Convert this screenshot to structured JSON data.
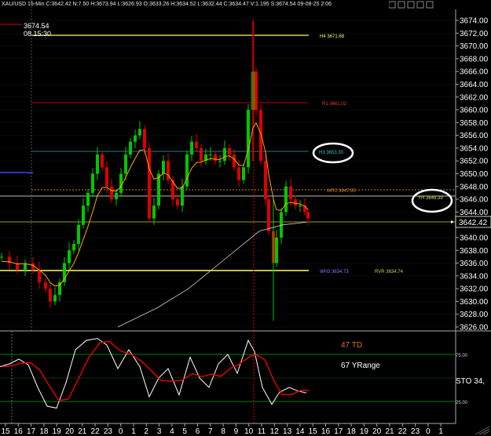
{
  "header": {
    "ohlc": "XAU/USD 15-Min C:3642.42 N:7.50 H:3673.94 L:3626.93 O:3633.26 H:3634.52 L:3632.44 C:3634.47 V:1.195 S:3674.54 09-08-25 2:06",
    "toolbar_label": "15:30 | C:3633.26 H:3634.52 L:3632.44 O:3634.47 V:1.195 S:3674.54 09-08-25 2:06"
  },
  "crosshair": {
    "price_label": "3674.54",
    "time_label": "08 15:30"
  },
  "levels": {
    "h4": "H4 3671.68",
    "r1": "R1 3661.02",
    "h3": "H3 3653.30",
    "wr1": "WR1 3647.65",
    "yh": "YH 3646.39",
    "wh3": "WH3 3634.73",
    "rvr": "RVR 3634.74"
  },
  "price_axis": {
    "labels": [
      "3674.00",
      "3672.00",
      "3670.00",
      "3668.00",
      "3666.00",
      "3664.00",
      "3662.00",
      "3660.00",
      "3658.00",
      "3656.00",
      "3654.00",
      "3652.00",
      "3650.00",
      "3648.00",
      "3646.00",
      "3644.00",
      "3642.00",
      "3640.00",
      "3638.00",
      "3636.00",
      "3634.00",
      "3632.00",
      "3630.00",
      "3628.00",
      "3626.00"
    ],
    "current": "3642.42"
  },
  "oscillator": {
    "td": "47 TD",
    "yrange": "67 YRange",
    "sto": "STO 34,",
    "level_75": "75.00",
    "level_25": "25.00"
  },
  "time_axis": {
    "labels": [
      "15",
      "16",
      "17",
      "18",
      "19",
      "20",
      "21",
      "22",
      "23",
      "0",
      "1",
      "2",
      "3",
      "4",
      "5",
      "6",
      "7",
      "8",
      "9",
      "10",
      "11",
      "12",
      "13",
      "14",
      "15",
      "16",
      "17",
      "18",
      "19",
      "20",
      "21",
      "22",
      "23",
      "0",
      "1"
    ]
  },
  "colors": {
    "bull": "#00c800",
    "bear": "#e00000",
    "ma_fast": "#ffa500",
    "ma_slow": "#e0e0e0",
    "yellow_level": "#ffff66",
    "red_level": "#c00000",
    "teal_level": "#40a0a0",
    "orange_level": "#d08020",
    "sto_k": "#ffffff",
    "sto_d": "#e00000"
  }
}
